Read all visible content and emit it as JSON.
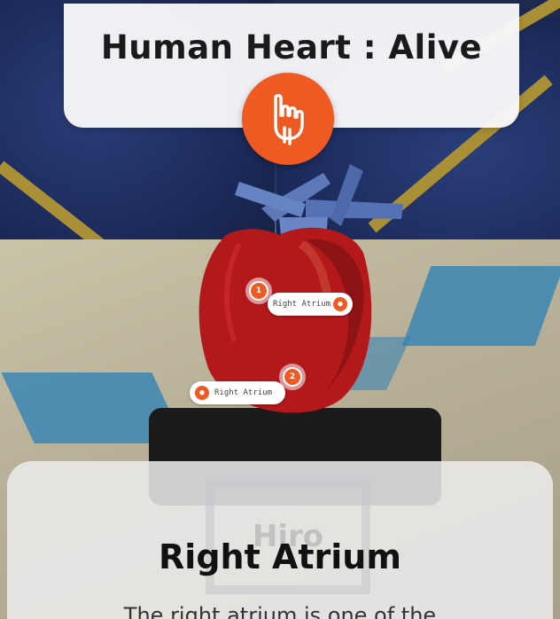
{
  "header": {
    "title": "Human Heart : Alive",
    "gesture_icon": "tap-hand-icon",
    "accent_color": "#ef5a22"
  },
  "annotations": [
    {
      "number": "1",
      "label": "Right Atrium"
    },
    {
      "number": "2",
      "label": "Right Atrium"
    }
  ],
  "marker": {
    "text": "Hiro"
  },
  "info_panel": {
    "title": "Right Atrium",
    "description": "The right atrium is one of the"
  }
}
